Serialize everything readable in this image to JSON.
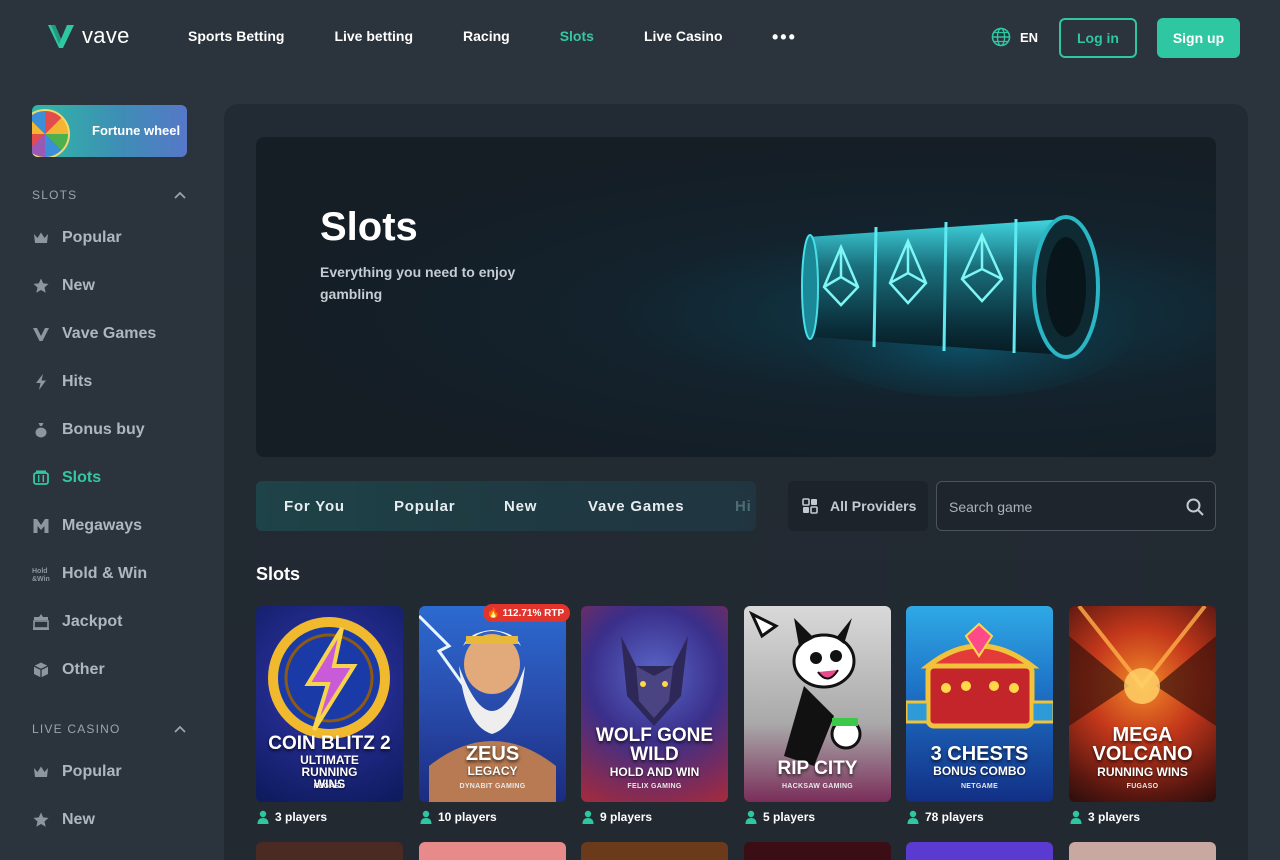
{
  "header": {
    "logo_text": "vave",
    "nav": [
      "Sports Betting",
      "Live betting",
      "Racing",
      "Slots",
      "Live Casino"
    ],
    "active_nav": "Slots",
    "more": "•••",
    "language": "EN",
    "login": "Log in",
    "signup": "Sign up"
  },
  "sidebar": {
    "fortune_wheel": "Fortune wheel",
    "slots_section": "SLOTS",
    "slots_items": [
      {
        "label": "Popular",
        "icon": "crown-icon"
      },
      {
        "label": "New",
        "icon": "star-icon"
      },
      {
        "label": "Vave Games",
        "icon": "vave-icon"
      },
      {
        "label": "Hits",
        "icon": "lightning-icon"
      },
      {
        "label": "Bonus buy",
        "icon": "money-bag-icon"
      },
      {
        "label": "Slots",
        "icon": "slot-machine-icon"
      },
      {
        "label": "Megaways",
        "icon": "megaways-icon"
      },
      {
        "label": "Hold & Win",
        "icon": "hold-win-icon"
      },
      {
        "label": "Jackpot",
        "icon": "jackpot-icon"
      },
      {
        "label": "Other",
        "icon": "cube-icon"
      }
    ],
    "live_section": "LIVE CASINO",
    "live_items": [
      {
        "label": "Popular",
        "icon": "crown-icon"
      },
      {
        "label": "New",
        "icon": "star-icon"
      }
    ]
  },
  "hero": {
    "title": "Slots",
    "subtitle": "Everything you need to enjoy gambling"
  },
  "tabs": [
    "For You",
    "Popular",
    "New",
    "Vave Games",
    "Hi"
  ],
  "providers_label": "All Providers",
  "search_placeholder": "Search game",
  "section_title": "Slots",
  "games": [
    {
      "title": "COIN BLITZ 2",
      "sub": "ULTIMATE RUNNING WINS",
      "provider": "FUGASO",
      "players": "3 players"
    },
    {
      "title": "ZEUS",
      "sub": "LEGACY",
      "provider": "DYNABIT GAMING",
      "players": "10 players",
      "rtp": "112.71% RTP"
    },
    {
      "title": "WOLF GONE WILD",
      "sub": "HOLD AND WIN",
      "provider": "FELIX GAMING",
      "players": "9 players"
    },
    {
      "title": "RIP CITY",
      "sub": "",
      "provider": "HACKSAW GAMING",
      "players": "5 players"
    },
    {
      "title": "3 CHESTS",
      "sub": "BONUS COMBO",
      "provider": "NETGAME",
      "players": "78 players"
    },
    {
      "title": "MEGA VOLCANO",
      "sub": "RUNNING WINS",
      "provider": "FUGASO",
      "players": "3 players"
    }
  ],
  "colors": {
    "accent": "#2fc6a2",
    "background": "#2b333d",
    "panel": "#222a33"
  }
}
